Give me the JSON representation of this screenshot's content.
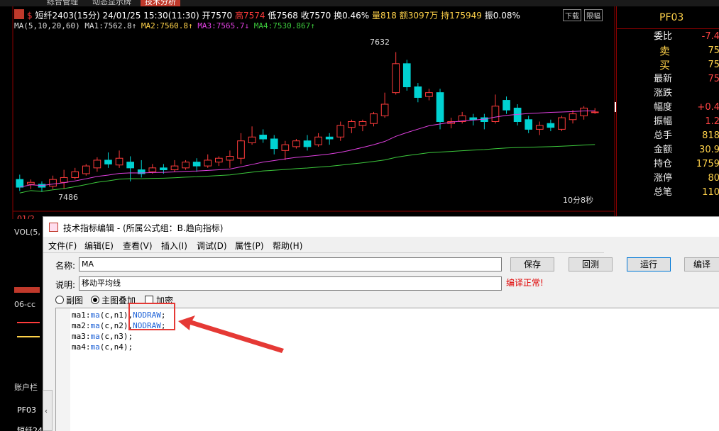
{
  "top_tabs": [
    "综合管理",
    "动态显示牌",
    "技术分析"
  ],
  "chart": {
    "symbol": "短纤2403(15分)",
    "datetime": "24/01/25 15:30(11:30)",
    "open_label": "开7570",
    "high_label": "高7574",
    "low_label": "低7568",
    "close_label": "收7570",
    "turnover_rate": "换0.46%",
    "volume": "量818",
    "amount": "额3097万",
    "open_interest": "持175949",
    "amp": "振0.08%",
    "btn_download": "下载",
    "btn_limit": "限幅",
    "ma_params": "MA(5,10,20,60)",
    "ma1": "MA1:7562.8↑",
    "ma2": "MA2:7560.8↑",
    "ma3": "MA3:7565.7↓",
    "ma4": "MA4:7530.867↑",
    "high_mark": "7632",
    "low_mark": "7486",
    "countdown": "10分8秒",
    "vol_label": "VOL(5,",
    "date_label": "01/2",
    "colors": {
      "up": "#ff3b3b",
      "down": "#00d2d2",
      "ma_pink": "#e040e0",
      "ma_green": "#3cc83c",
      "ma_white": "#dddddd"
    }
  },
  "chart_data": {
    "type": "candlestick",
    "y_ticks": [
      "7600",
      "7550",
      "7500"
    ],
    "ylim": [
      7470,
      7650
    ],
    "current_price_tag": "7570",
    "candles": [
      {
        "o": 7500,
        "c": 7492,
        "h": 7505,
        "l": 7488
      },
      {
        "o": 7495,
        "c": 7497,
        "h": 7500,
        "l": 7490
      },
      {
        "o": 7495,
        "c": 7492,
        "h": 7498,
        "l": 7487
      },
      {
        "o": 7493,
        "c": 7500,
        "h": 7504,
        "l": 7490
      },
      {
        "o": 7497,
        "c": 7502,
        "h": 7510,
        "l": 7490
      },
      {
        "o": 7502,
        "c": 7508,
        "h": 7512,
        "l": 7500
      },
      {
        "o": 7506,
        "c": 7514,
        "h": 7516,
        "l": 7504
      },
      {
        "o": 7512,
        "c": 7520,
        "h": 7523,
        "l": 7508
      },
      {
        "o": 7520,
        "c": 7516,
        "h": 7528,
        "l": 7512
      },
      {
        "o": 7515,
        "c": 7522,
        "h": 7530,
        "l": 7512
      },
      {
        "o": 7518,
        "c": 7512,
        "h": 7524,
        "l": 7498
      },
      {
        "o": 7510,
        "c": 7506,
        "h": 7520,
        "l": 7502
      },
      {
        "o": 7508,
        "c": 7512,
        "h": 7516,
        "l": 7506
      },
      {
        "o": 7512,
        "c": 7510,
        "h": 7516,
        "l": 7506
      },
      {
        "o": 7510,
        "c": 7514,
        "h": 7520,
        "l": 7508
      },
      {
        "o": 7512,
        "c": 7518,
        "h": 7520,
        "l": 7510
      },
      {
        "o": 7518,
        "c": 7514,
        "h": 7522,
        "l": 7508
      },
      {
        "o": 7514,
        "c": 7520,
        "h": 7526,
        "l": 7512
      },
      {
        "o": 7518,
        "c": 7522,
        "h": 7524,
        "l": 7514
      },
      {
        "o": 7520,
        "c": 7524,
        "h": 7530,
        "l": 7512
      },
      {
        "o": 7522,
        "c": 7540,
        "h": 7548,
        "l": 7516
      },
      {
        "o": 7538,
        "c": 7544,
        "h": 7555,
        "l": 7536
      },
      {
        "o": 7546,
        "c": 7542,
        "h": 7552,
        "l": 7538
      },
      {
        "o": 7542,
        "c": 7532,
        "h": 7546,
        "l": 7526
      },
      {
        "o": 7530,
        "c": 7536,
        "h": 7540,
        "l": 7520
      },
      {
        "o": 7534,
        "c": 7540,
        "h": 7542,
        "l": 7532
      },
      {
        "o": 7540,
        "c": 7534,
        "h": 7546,
        "l": 7530
      },
      {
        "o": 7536,
        "c": 7544,
        "h": 7548,
        "l": 7534
      },
      {
        "o": 7544,
        "c": 7542,
        "h": 7548,
        "l": 7536
      },
      {
        "o": 7544,
        "c": 7556,
        "h": 7560,
        "l": 7540
      },
      {
        "o": 7554,
        "c": 7560,
        "h": 7562,
        "l": 7548
      },
      {
        "o": 7556,
        "c": 7560,
        "h": 7562,
        "l": 7550
      },
      {
        "o": 7558,
        "c": 7568,
        "h": 7570,
        "l": 7555
      },
      {
        "o": 7566,
        "c": 7578,
        "h": 7590,
        "l": 7564
      },
      {
        "o": 7590,
        "c": 7620,
        "h": 7632,
        "l": 7588
      },
      {
        "o": 7620,
        "c": 7596,
        "h": 7624,
        "l": 7592
      },
      {
        "o": 7596,
        "c": 7585,
        "h": 7600,
        "l": 7580
      },
      {
        "o": 7586,
        "c": 7590,
        "h": 7594,
        "l": 7582
      },
      {
        "o": 7590,
        "c": 7560,
        "h": 7594,
        "l": 7552
      },
      {
        "o": 7558,
        "c": 7560,
        "h": 7564,
        "l": 7553
      },
      {
        "o": 7560,
        "c": 7566,
        "h": 7570,
        "l": 7558
      },
      {
        "o": 7564,
        "c": 7562,
        "h": 7568,
        "l": 7556
      },
      {
        "o": 7564,
        "c": 7560,
        "h": 7568,
        "l": 7552
      },
      {
        "o": 7560,
        "c": 7576,
        "h": 7588,
        "l": 7558
      },
      {
        "o": 7582,
        "c": 7572,
        "h": 7586,
        "l": 7568
      },
      {
        "o": 7574,
        "c": 7560,
        "h": 7578,
        "l": 7556
      },
      {
        "o": 7562,
        "c": 7552,
        "h": 7566,
        "l": 7548
      },
      {
        "o": 7552,
        "c": 7556,
        "h": 7560,
        "l": 7546
      },
      {
        "o": 7558,
        "c": 7554,
        "h": 7562,
        "l": 7550
      },
      {
        "o": 7552,
        "c": 7564,
        "h": 7566,
        "l": 7550
      },
      {
        "o": 7562,
        "c": 7568,
        "h": 7572,
        "l": 7558
      },
      {
        "o": 7566,
        "c": 7574,
        "h": 7576,
        "l": 7562
      },
      {
        "o": 7570,
        "c": 7570,
        "h": 7574,
        "l": 7568
      }
    ]
  },
  "right_panel": {
    "code": "PF03",
    "rows": [
      {
        "label": "委比",
        "value": "-7.4"
      },
      {
        "label": "卖",
        "value": "75"
      },
      {
        "label": "买",
        "value": "75"
      },
      {
        "label": "最新",
        "value": "75"
      },
      {
        "label": "涨跌",
        "value": ""
      },
      {
        "label": "幅度",
        "value": "+0.4"
      },
      {
        "label": "振幅",
        "value": "1.2"
      },
      {
        "label": "总手",
        "value": "818"
      },
      {
        "label": "金额",
        "value": "30.9"
      },
      {
        "label": "持仓",
        "value": "1759"
      },
      {
        "label": "涨停",
        "value": "80"
      },
      {
        "label": "总笔",
        "value": "110"
      }
    ]
  },
  "left_strip": {
    "label_06": "06-cc",
    "account": "账户栏",
    "pf03": "PF03",
    "short": "短纤24"
  },
  "dialog": {
    "title": "技术指标编辑 - (所属公式组：B.趋向指标)",
    "menus": [
      "文件(F)",
      "编辑(E)",
      "查看(V)",
      "插入(I)",
      "调试(D)",
      "属性(P)",
      "帮助(H)"
    ],
    "name_label": "名称:",
    "name_value": "MA",
    "desc_label": "说明:",
    "desc_value": "移动平均线",
    "status": "编译正常!",
    "buttons": {
      "save": "保存",
      "backtest": "回测",
      "run": "运行",
      "compile": "编译"
    },
    "options": {
      "sub_chart": "副图",
      "main_overlay": "主图叠加",
      "encrypt": "加密"
    },
    "code_lines": [
      {
        "prefix": "ma1:",
        "fn": "ma",
        "args": "(c,n1)",
        "suffix": ",",
        "kw": "NODRAW",
        "end": ";"
      },
      {
        "prefix": "ma2:",
        "fn": "ma",
        "args": "(c,n2)",
        "suffix": ",",
        "kw": "NODRAW",
        "end": ";"
      },
      {
        "prefix": "ma3:",
        "fn": "ma",
        "args": "(c,n3)",
        "suffix": "",
        "kw": "",
        "end": ";"
      },
      {
        "prefix": "ma4:",
        "fn": "ma",
        "args": "(c,n4)",
        "suffix": "",
        "kw": "",
        "end": ";"
      }
    ]
  }
}
